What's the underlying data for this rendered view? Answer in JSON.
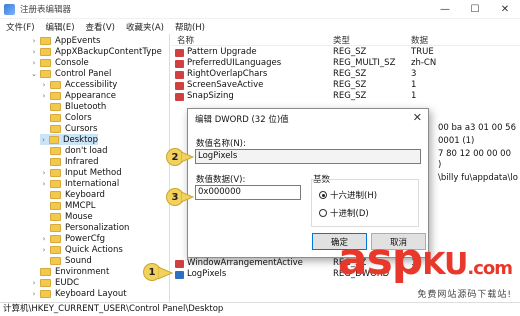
{
  "window": {
    "title": "注册表编辑器",
    "controls": [
      "—",
      "☐",
      "✕"
    ]
  },
  "menu": [
    "文件(F)",
    "编辑(E)",
    "查看(V)",
    "收藏夹(A)",
    "帮助(H)"
  ],
  "tree": [
    "AppEvents",
    "AppXBackupContentType",
    "Console",
    "Control Panel",
    "Accessibility",
    "Appearance",
    "Bluetooth",
    "Colors",
    "Cursors",
    "Desktop",
    "don't load",
    "Infrared",
    "Input Method",
    "International",
    "Keyboard",
    "MMCPL",
    "Mouse",
    "Personalization",
    "PowerCfg",
    "Quick Actions",
    "Sound",
    "Environment",
    "EUDC",
    "Keyboard Layout"
  ],
  "columns": {
    "name": "名称",
    "type": "类型",
    "data": "数据"
  },
  "rows": [
    {
      "name": "Pattern Upgrade",
      "type": "REG_SZ",
      "data": "TRUE"
    },
    {
      "name": "PreferredUILanguages",
      "type": "REG_MULTI_SZ",
      "data": "zh-CN"
    },
    {
      "name": "RightOverlapChars",
      "type": "REG_SZ",
      "data": "3"
    },
    {
      "name": "ScreenSaveActive",
      "type": "REG_SZ",
      "data": "1"
    },
    {
      "name": "SnapSizing",
      "type": "REG_SZ",
      "data": "1"
    }
  ],
  "right_partial": [
    "00 ba a3 01 00 56",
    "0001 (1)",
    "7 80 12 00 00 00",
    ")",
    "\\billy fu\\appdata\\lo"
  ],
  "bottom_rows": [
    {
      "name": "WindowArrangementActive",
      "type": "REG_SZ",
      "data": "1"
    },
    {
      "name": "LogPixels",
      "type": "REG_DWORD",
      "data": ""
    }
  ],
  "status": "计算机\\HKEY_CURRENT_USER\\Control Panel\\Desktop",
  "dialog": {
    "title": "编辑 DWORD (32 位)值",
    "name_label": "数值名称(N):",
    "name_value": "LogPixels",
    "data_label": "数值数据(V):",
    "data_value": "0x000000",
    "base_label": "基数",
    "hex_label": "十六进制(H)",
    "dec_label": "十进制(D)",
    "ok": "确定",
    "cancel": "取消"
  },
  "callouts": [
    "1",
    "2",
    "3"
  ],
  "watermark": {
    "big": "asp",
    "ku": "KU",
    "com": ".com",
    "sub": "免费网站源码下载站!"
  }
}
